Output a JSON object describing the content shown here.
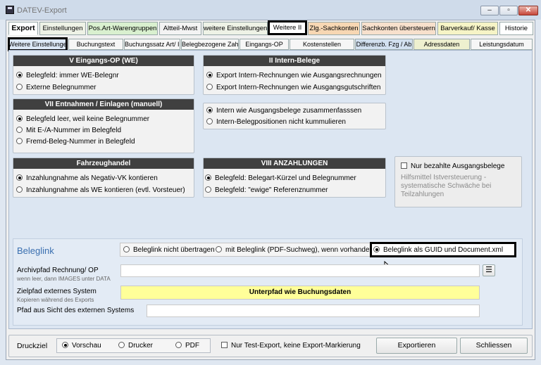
{
  "window": {
    "title": "DATEV-Export",
    "minimize": "–",
    "maximize": "▫",
    "close": "✕"
  },
  "top_tabs": [
    {
      "label": "Export"
    },
    {
      "label": "Einstellungen"
    },
    {
      "label": "Pos.Art-Warengruppen"
    },
    {
      "label": "Altteil-Mwst"
    },
    {
      "label": "weitere Einstellungen"
    },
    {
      "label": "Weitere II"
    },
    {
      "label": "Zlg.-Sachkonten"
    },
    {
      "label": "Sachkonten übersteuern"
    },
    {
      "label": "Barverkauf/ Kasse"
    },
    {
      "label": "Historie"
    }
  ],
  "sub_tabs": [
    {
      "label": "Weitere Einstellunge"
    },
    {
      "label": "Buchungstext"
    },
    {
      "label": "Buchungssatz Art/ In"
    },
    {
      "label": "Belegbezogene Zah"
    },
    {
      "label": "Eingangs-OP"
    },
    {
      "label": "Kostenstellen"
    },
    {
      "label": "Differenzb. Fzg / Ab"
    },
    {
      "label": "Adressdaten"
    },
    {
      "label": "Leistungsdatum"
    }
  ],
  "groups": {
    "eingangs_op": {
      "title": "V Eingangs-OP (WE)",
      "options": [
        "Belegfeld: immer WE-Belegnr",
        "Externe Belegnummer"
      ],
      "selected": 0
    },
    "entnahmen": {
      "title": "VII Entnahmen / Einlagen (manuell)",
      "options": [
        "Belegfeld leer, weil keine Belegnummer",
        "Mit E-/A-Nummer im Belegfeld",
        "Fremd-Beleg-Nummer in Belegfeld"
      ],
      "selected": 0
    },
    "fahrzeughandel": {
      "title": "Fahrzeughandel",
      "options": [
        "Inzahlungnahme als Negativ-VK kontieren",
        "Inzahlungnahme als WE kontieren (evtl. Vorsteuer)"
      ],
      "selected": 0
    },
    "intern_belege": {
      "title": "II Intern-Belege",
      "options": [
        "Export Intern-Rechnungen wie Ausgangsrechnungen",
        "Export Intern-Rechnungen wie Ausgangsgutschriften"
      ],
      "selected": 0
    },
    "intern_zusammen": {
      "options": [
        "Intern wie Ausgangsbelege zusammenfasssen",
        "Intern-Belegpositionen nicht kummulieren"
      ],
      "selected": 0
    },
    "anzahlungen": {
      "title": "VIII ANZAHLUNGEN",
      "options": [
        "Belegfeld: Belegart-Kürzel und Belegnummer",
        "Belegfeld: \"ewige\" Referenznummer"
      ],
      "selected": 0
    }
  },
  "ist_box": {
    "checkbox_label": "Nur bezahlte Ausgangsbelege",
    "checked": false,
    "note_line1": "Hilfsmittel Istversteuerung -",
    "note_line2": "systematische Schwäche bei",
    "note_line3": "Teilzahlungen"
  },
  "beleglink": {
    "title": "Beleglink",
    "options": [
      "Beleglink nicht übertragen",
      "mit Beleglink (PDF-Suchweg), wenn vorhanden",
      "Beleglink als GUID und Document.xml"
    ],
    "selected": 2,
    "archiv_label": "Archivpfad Rechnung/ OP",
    "archiv_hint": "wenn leer, dann IMAGES unter DATA",
    "archiv_value": "",
    "ziel_label": "Zielpfad externes System",
    "ziel_hint": "Kopieren während des Exports",
    "ziel_button": "Unterpfad wie Buchungsdaten",
    "pfad_label": "Pfad aus Sicht des externen Systems",
    "pfad_value": ""
  },
  "footer": {
    "druckziel_label": "Druckziel",
    "druckziel_options": [
      "Vorschau",
      "Drucker",
      "PDF"
    ],
    "druckziel_selected": 0,
    "test_export_label": "Nur Test-Export, keine Export-Markierung",
    "test_export_checked": false,
    "export_button": "Exportieren",
    "close_button": "Schliessen"
  },
  "icons": {
    "menu": "hamburger-icon",
    "app": "floppy-disk-icon",
    "cursor": "mouse-pointer-icon"
  }
}
